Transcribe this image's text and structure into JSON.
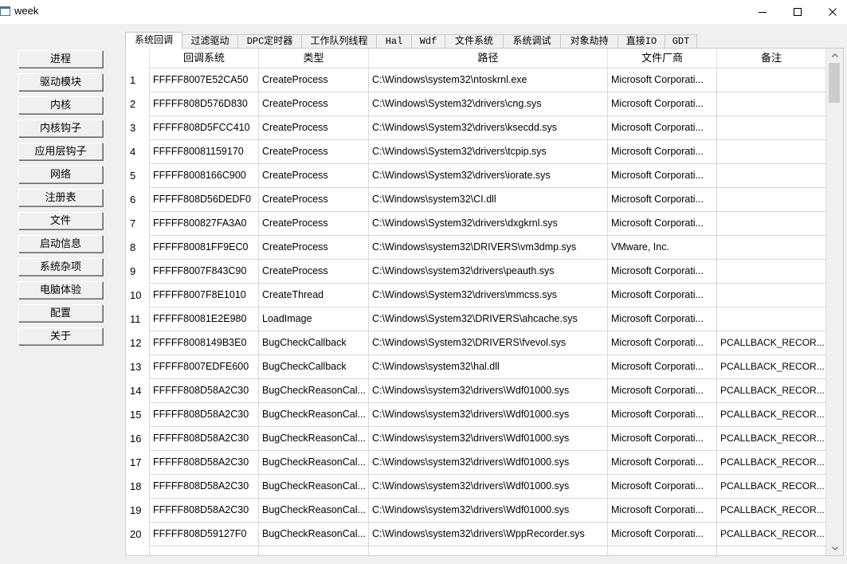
{
  "window": {
    "title": "week",
    "icons": {
      "app": "app-window-icon",
      "minimize": "minimize-icon",
      "maximize": "maximize-icon",
      "close": "close-icon"
    }
  },
  "colors": {
    "client_bg": "#f0f0f0",
    "titlebar_bg": "#ffffff",
    "pane_bg": "#ffffff",
    "selected_tab_bg": "#ffffff",
    "grid_line": "#d9d9d9",
    "text": "#000000"
  },
  "sidebar": {
    "items": [
      {
        "label": "进程"
      },
      {
        "label": "驱动模块"
      },
      {
        "label": "内核"
      },
      {
        "label": "内核钩子"
      },
      {
        "label": "应用层钩子"
      },
      {
        "label": "网络"
      },
      {
        "label": "注册表"
      },
      {
        "label": "文件"
      },
      {
        "label": "启动信息"
      },
      {
        "label": "系统杂项"
      },
      {
        "label": "电脑体验"
      },
      {
        "label": "配置"
      },
      {
        "label": "关于"
      }
    ]
  },
  "tabs": {
    "items": [
      {
        "label": "系统回调",
        "selected": true
      },
      {
        "label": "过滤驱动",
        "selected": false
      },
      {
        "label": "DPC定时器",
        "selected": false
      },
      {
        "label": "工作队列线程",
        "selected": false
      },
      {
        "label": "Hal",
        "selected": false
      },
      {
        "label": "Wdf",
        "selected": false
      },
      {
        "label": "文件系统",
        "selected": false
      },
      {
        "label": "系统调试",
        "selected": false
      },
      {
        "label": "对象劫持",
        "selected": false
      },
      {
        "label": "直接IO",
        "selected": false
      },
      {
        "label": "GDT",
        "selected": false
      }
    ]
  },
  "table": {
    "columns": [
      "回调系统",
      "类型",
      "路径",
      "文件厂商",
      "备注"
    ],
    "rows": [
      {
        "num": 1,
        "address": "FFFFF8007E52CA50",
        "type": "CreateProcess",
        "path": "C:\\Windows\\system32\\ntoskrnl.exe",
        "vendor": "Microsoft Corporati...",
        "note": ""
      },
      {
        "num": 2,
        "address": "FFFFF808D576D830",
        "type": "CreateProcess",
        "path": "C:\\Windows\\System32\\drivers\\cng.sys",
        "vendor": "Microsoft Corporati...",
        "note": ""
      },
      {
        "num": 3,
        "address": "FFFFF808D5FCC410",
        "type": "CreateProcess",
        "path": "C:\\Windows\\System32\\drivers\\ksecdd.sys",
        "vendor": "Microsoft Corporati...",
        "note": ""
      },
      {
        "num": 4,
        "address": "FFFFF80081159170",
        "type": "CreateProcess",
        "path": "C:\\Windows\\System32\\drivers\\tcpip.sys",
        "vendor": "Microsoft Corporati...",
        "note": ""
      },
      {
        "num": 5,
        "address": "FFFFF8008166C900",
        "type": "CreateProcess",
        "path": "C:\\Windows\\System32\\drivers\\iorate.sys",
        "vendor": "Microsoft Corporati...",
        "note": ""
      },
      {
        "num": 6,
        "address": "FFFFF808D56DEDF0",
        "type": "CreateProcess",
        "path": "C:\\Windows\\system32\\CI.dll",
        "vendor": "Microsoft Corporati...",
        "note": ""
      },
      {
        "num": 7,
        "address": "FFFFF800827FA3A0",
        "type": "CreateProcess",
        "path": "C:\\Windows\\System32\\drivers\\dxgkrnl.sys",
        "vendor": "Microsoft Corporati...",
        "note": ""
      },
      {
        "num": 8,
        "address": "FFFFF80081FF9EC0",
        "type": "CreateProcess",
        "path": "C:\\Windows\\system32\\DRIVERS\\vm3dmp.sys",
        "vendor": "VMware, Inc.",
        "note": ""
      },
      {
        "num": 9,
        "address": "FFFFF8007F843C90",
        "type": "CreateProcess",
        "path": "C:\\Windows\\system32\\drivers\\peauth.sys",
        "vendor": "Microsoft Corporati...",
        "note": ""
      },
      {
        "num": 10,
        "address": "FFFFF8007F8E1010",
        "type": "CreateThread",
        "path": "C:\\Windows\\System32\\drivers\\mmcss.sys",
        "vendor": "Microsoft Corporati...",
        "note": ""
      },
      {
        "num": 11,
        "address": "FFFFF80081E2E980",
        "type": "LoadImage",
        "path": "C:\\Windows\\System32\\DRIVERS\\ahcache.sys",
        "vendor": "Microsoft Corporati...",
        "note": ""
      },
      {
        "num": 12,
        "address": "FFFFF8008149B3E0",
        "type": "BugCheckCallback",
        "path": "C:\\Windows\\System32\\DRIVERS\\fvevol.sys",
        "vendor": "Microsoft Corporati...",
        "note": "PCALLBACK_RECOR..."
      },
      {
        "num": 13,
        "address": "FFFFF8007EDFE600",
        "type": "BugCheckCallback",
        "path": "C:\\Windows\\system32\\hal.dll",
        "vendor": "Microsoft Corporati...",
        "note": "PCALLBACK_RECOR..."
      },
      {
        "num": 14,
        "address": "FFFFF808D58A2C30",
        "type": "BugCheckReasonCal...",
        "path": "C:\\Windows\\system32\\drivers\\Wdf01000.sys",
        "vendor": "Microsoft Corporati...",
        "note": "PCALLBACK_RECOR..."
      },
      {
        "num": 15,
        "address": "FFFFF808D58A2C30",
        "type": "BugCheckReasonCal...",
        "path": "C:\\Windows\\system32\\drivers\\Wdf01000.sys",
        "vendor": "Microsoft Corporati...",
        "note": "PCALLBACK_RECOR..."
      },
      {
        "num": 16,
        "address": "FFFFF808D58A2C30",
        "type": "BugCheckReasonCal...",
        "path": "C:\\Windows\\system32\\drivers\\Wdf01000.sys",
        "vendor": "Microsoft Corporati...",
        "note": "PCALLBACK_RECOR..."
      },
      {
        "num": 17,
        "address": "FFFFF808D58A2C30",
        "type": "BugCheckReasonCal...",
        "path": "C:\\Windows\\system32\\drivers\\Wdf01000.sys",
        "vendor": "Microsoft Corporati...",
        "note": "PCALLBACK_RECOR..."
      },
      {
        "num": 18,
        "address": "FFFFF808D58A2C30",
        "type": "BugCheckReasonCal...",
        "path": "C:\\Windows\\system32\\drivers\\Wdf01000.sys",
        "vendor": "Microsoft Corporati...",
        "note": "PCALLBACK_RECOR..."
      },
      {
        "num": 19,
        "address": "FFFFF808D58A2C30",
        "type": "BugCheckReasonCal...",
        "path": "C:\\Windows\\system32\\drivers\\Wdf01000.sys",
        "vendor": "Microsoft Corporati...",
        "note": "PCALLBACK_RECOR..."
      },
      {
        "num": 20,
        "address": "FFFFF808D59127F0",
        "type": "BugCheckReasonCal...",
        "path": "C:\\Windows\\system32\\drivers\\WppRecorder.sys",
        "vendor": "Microsoft Corporati...",
        "note": "PCALLBACK_RECOR..."
      }
    ]
  },
  "scrollbar": {
    "icons": {
      "up": "chevron-up-icon",
      "down": "chevron-down-icon"
    }
  }
}
